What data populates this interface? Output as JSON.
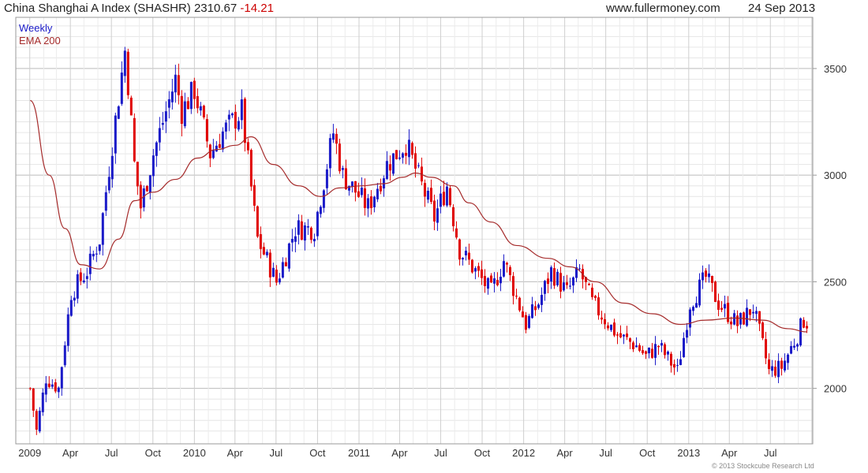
{
  "header": {
    "title": "China Shanghai A Index (SHASHR) 2310.67",
    "change": "-14.21",
    "site": "www.fullermoney.com",
    "date": "24 Sep 2013"
  },
  "legend": {
    "series1": "Weekly",
    "series2": "EMA 200"
  },
  "copyright": "© 2013 Stockcube Research Ltd",
  "colors": {
    "up": "#1a1ac8",
    "down": "#e00000",
    "ema": "#a52a2a",
    "grid": "#cccccc"
  },
  "chart_data": {
    "type": "candlestick",
    "title": "China Shanghai A Index (SHASHR)",
    "frequency": "Weekly",
    "ylim": [
      1740,
      3740
    ],
    "y_ticks": [
      2000,
      2500,
      3000,
      3500
    ],
    "x_tick_labels": [
      "2009",
      "Apr",
      "Jul",
      "Oct",
      "2010",
      "Apr",
      "Jul",
      "Oct",
      "2011",
      "Apr",
      "Jul",
      "Oct",
      "2012",
      "Apr",
      "Jul",
      "Oct",
      "2013",
      "Apr",
      "Jul"
    ],
    "grid": true,
    "legend": "top-left",
    "close_path": [
      [
        "2009-01-02",
        2000
      ],
      [
        "2009-01-16",
        1800
      ],
      [
        "2009-02-06",
        2050
      ],
      [
        "2009-03-06",
        2000
      ],
      [
        "2009-04-03",
        2450
      ],
      [
        "2009-05-08",
        2550
      ],
      [
        "2009-06-05",
        2700
      ],
      [
        "2009-07-03",
        3150
      ],
      [
        "2009-08-01",
        3600
      ],
      [
        "2009-08-21",
        3050
      ],
      [
        "2009-09-04",
        2850
      ],
      [
        "2009-10-02",
        3100
      ],
      [
        "2009-11-20",
        3450
      ],
      [
        "2009-12-04",
        3300
      ],
      [
        "2010-01-01",
        3400
      ],
      [
        "2010-02-05",
        3100
      ],
      [
        "2010-03-05",
        3200
      ],
      [
        "2010-04-16",
        3300
      ],
      [
        "2010-05-21",
        2700
      ],
      [
        "2010-07-02",
        2500
      ],
      [
        "2010-08-13",
        2750
      ],
      [
        "2010-09-24",
        2750
      ],
      [
        "2010-11-05",
        3200
      ],
      [
        "2010-11-26",
        3000
      ],
      [
        "2011-01-21",
        2850
      ],
      [
        "2011-03-04",
        3050
      ],
      [
        "2011-04-15",
        3150
      ],
      [
        "2011-05-20",
        2950
      ],
      [
        "2011-06-17",
        2800
      ],
      [
        "2011-07-15",
        2950
      ],
      [
        "2011-08-12",
        2650
      ],
      [
        "2011-10-21",
        2450
      ],
      [
        "2011-11-18",
        2600
      ],
      [
        "2012-01-06",
        2300
      ],
      [
        "2012-02-03",
        2400
      ],
      [
        "2012-03-02",
        2550
      ],
      [
        "2012-04-06",
        2450
      ],
      [
        "2012-05-04",
        2550
      ],
      [
        "2012-06-01",
        2400
      ],
      [
        "2012-07-27",
        2250
      ],
      [
        "2012-09-07",
        2200
      ],
      [
        "2012-09-28",
        2150
      ],
      [
        "2012-10-26",
        2200
      ],
      [
        "2012-12-07",
        2080
      ],
      [
        "2013-01-04",
        2400
      ],
      [
        "2013-02-08",
        2520
      ],
      [
        "2013-03-08",
        2400
      ],
      [
        "2013-04-19",
        2300
      ],
      [
        "2013-05-24",
        2380
      ],
      [
        "2013-06-28",
        2080
      ],
      [
        "2013-07-26",
        2100
      ],
      [
        "2013-08-30",
        2250
      ],
      [
        "2013-09-13",
        2320
      ],
      [
        "2013-09-20",
        2310
      ]
    ],
    "ema_200": [
      [
        "2009-01-02",
        3350
      ],
      [
        "2009-02-13",
        3000
      ],
      [
        "2009-03-20",
        2750
      ],
      [
        "2009-04-24",
        2580
      ],
      [
        "2009-06-05",
        2560
      ],
      [
        "2009-07-17",
        2700
      ],
      [
        "2009-08-21",
        2880
      ],
      [
        "2009-10-02",
        2920
      ],
      [
        "2009-11-20",
        2980
      ],
      [
        "2010-01-08",
        3080
      ],
      [
        "2010-02-19",
        3120
      ],
      [
        "2010-04-02",
        3140
      ],
      [
        "2010-05-07",
        3180
      ],
      [
        "2010-06-25",
        3050
      ],
      [
        "2010-08-20",
        2950
      ],
      [
        "2010-10-08",
        2900
      ],
      [
        "2010-11-19",
        2940
      ],
      [
        "2011-01-07",
        2950
      ],
      [
        "2011-02-25",
        2960
      ],
      [
        "2011-04-08",
        2990
      ],
      [
        "2011-05-06",
        3010
      ],
      [
        "2011-06-10",
        2990
      ],
      [
        "2011-07-29",
        2950
      ],
      [
        "2011-09-02",
        2870
      ],
      [
        "2011-10-21",
        2780
      ],
      [
        "2011-12-16",
        2670
      ],
      [
        "2012-02-24",
        2610
      ],
      [
        "2012-04-13",
        2570
      ],
      [
        "2012-06-08",
        2500
      ],
      [
        "2012-08-10",
        2400
      ],
      [
        "2012-10-12",
        2350
      ],
      [
        "2012-12-14",
        2300
      ],
      [
        "2013-02-08",
        2320
      ],
      [
        "2013-04-12",
        2330
      ],
      [
        "2013-06-14",
        2320
      ],
      [
        "2013-08-09",
        2280
      ],
      [
        "2013-09-20",
        2265
      ]
    ]
  }
}
